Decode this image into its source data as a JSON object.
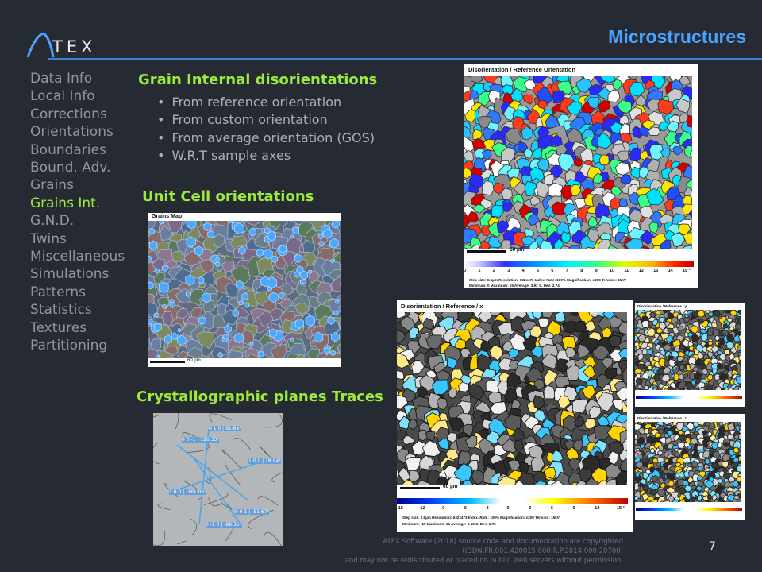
{
  "header": {
    "logo": "TEX",
    "title": "Microstructures"
  },
  "nav": {
    "items": [
      "Data Info",
      "Local Info",
      "Corrections",
      "Orientations",
      "Boundaries",
      "Bound. Adv.",
      "Grains",
      "Grains Int.",
      "G.N.D.",
      "Twins",
      "Miscellaneous",
      "Simulations",
      "Patterns",
      "Statistics",
      "Textures",
      "Partitioning"
    ],
    "active": "Grains Int."
  },
  "sections": {
    "grain_internal": {
      "title": "Grain Internal disorientations",
      "bullets": [
        "From reference orientation",
        "From custom orientation",
        "From average orientation (GOS)",
        "W.R.T sample axes"
      ]
    },
    "unit_cell": {
      "title": "Unit Cell orientations",
      "map_title": "Grains Map",
      "scale": "60 µm"
    },
    "planes": {
      "title": "Crystallographic  planes Traces",
      "labels": [
        "0 1 0 | 91.64°",
        "0 0 -1 | 126.33°",
        "1 0 0 | 18.94°",
        "1 0 0 | -161.06°",
        "0 0 1 | -51.67°",
        "0 -1 0 | -88.36°"
      ]
    }
  },
  "figures": {
    "reference": {
      "title": "Disorientation / Reference Orientation",
      "scale": "60 µm",
      "ticks": [
        "0",
        "1",
        "2",
        "3",
        "4",
        "5",
        "6",
        "7",
        "8",
        "9",
        "10",
        "11",
        "12",
        "13",
        "14",
        "15 °"
      ],
      "stats1": "Step size: 0.5µm    Resolution: 632x473    Index. Rate: 100%    Magnification: x200    Tension: 15kV",
      "stats2": "Minimum: 0    Maximum: 15    Average: 3.92    S. Dev: 2.74"
    },
    "ref_x": {
      "title": "Disorientation / Reference / x",
      "scale": "60 µm",
      "ticks": [
        "-15",
        "-12",
        "-9",
        "-6",
        "-3",
        "0",
        "3",
        "6",
        "9",
        "12",
        "15 °"
      ],
      "stats1": "Step size: 0.5µm    Resolution: 632x473    Index. Rate: 100%    Magnification: x200    Tension: 15kV",
      "stats2": "Minimum: -15    Maximum: 15    Average: 0.15    S. Dev: 2.79"
    },
    "ref_y": {
      "title": "Disorientation / Reference / y"
    },
    "ref_z": {
      "title": "Disorientation / Reference / z"
    }
  },
  "footer": {
    "line1": "ATEX Software (2018) source code and documentation are copyrighted (IDDN.FR.001.420015.000.R.P.2014.000.20700)",
    "line2": "and may not be redistributed or placed on public Web servers without permission.",
    "page": "7"
  },
  "colors": {
    "background": "#262b33",
    "accent": "#9cea3c",
    "title": "#4aa3ff",
    "nav": "#8e96a0"
  }
}
